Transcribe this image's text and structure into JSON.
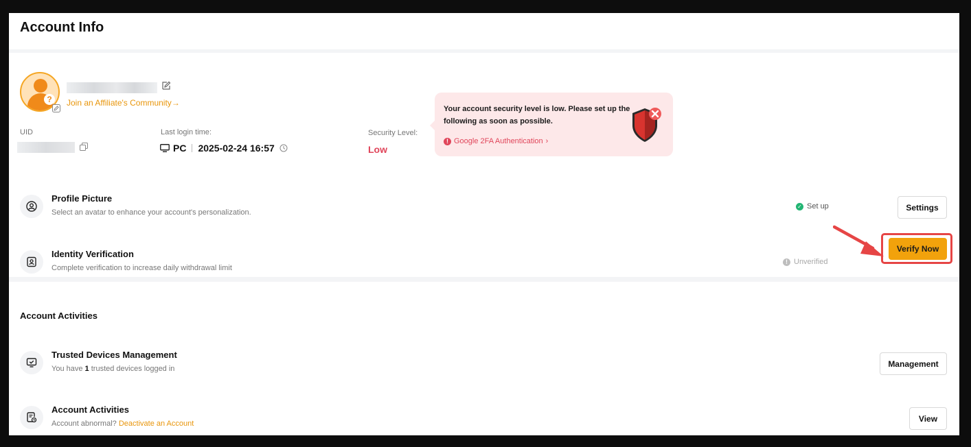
{
  "header": {
    "title": "Account Info"
  },
  "profile": {
    "affiliate_link": "Join an Affiliate's Community",
    "affiliate_arrow": "→"
  },
  "info": {
    "uid_label": "UID",
    "last_login_label": "Last login time",
    "last_login_device": "PC",
    "last_login_time": "2025-02-24 16:57",
    "security_label": "Security Level",
    "security_value": "Low"
  },
  "alert": {
    "message": "Your account security level is low. Please set up the following as soon as possible.",
    "link": "Google 2FA Authentication",
    "link_arrow": "›"
  },
  "rows": [
    {
      "title": "Profile Picture",
      "desc": "Select an avatar to enhance your account's personalization.",
      "status": "Set up",
      "button": "Settings"
    },
    {
      "title": "Identity Verification",
      "desc": "Complete verification to increase daily withdrawal limit",
      "status": "Unverified",
      "button": "Verify Now"
    }
  ],
  "activities": {
    "title": "Account Activities",
    "rows": [
      {
        "title": "Trusted Devices Management",
        "desc_prefix": "You have",
        "desc_count": "1",
        "desc_suffix": "trusted devices logged in",
        "button": "Management"
      },
      {
        "title": "Account Activities",
        "desc_prefix": "Account abnormal?",
        "desc_link": "Deactivate an Account",
        "button": "View"
      }
    ]
  },
  "colors": {
    "accent": "#f2a20c",
    "danger": "#e0455a",
    "success": "#22b573",
    "link": "#e8950a"
  },
  "icons": {
    "profile": "user-circle-icon",
    "identity": "id-badge-icon",
    "devices": "monitor-check-icon",
    "activities": "document-clock-icon",
    "shield": "shield-x-icon"
  }
}
